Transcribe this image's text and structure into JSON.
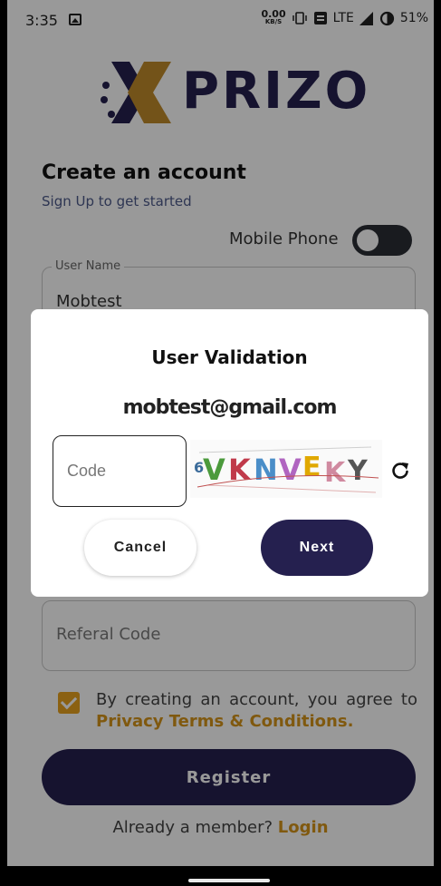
{
  "status_bar": {
    "time": "3:35",
    "speed_value": "0.00",
    "speed_unit": "KB/S",
    "network": "LTE",
    "battery": "51%"
  },
  "logo": {
    "text": "PRIZO",
    "colors": {
      "primary": "#25204f",
      "accent": "#c08a2a"
    }
  },
  "header": {
    "title": "Create an account",
    "subtitle": "Sign Up to get started"
  },
  "mobile_phone": {
    "label": "Mobile Phone",
    "enabled": false
  },
  "form": {
    "username": {
      "label": "User Name",
      "value": "Mobtest"
    },
    "referral_code": {
      "placeholder": "Referal Code"
    }
  },
  "agreement": {
    "checked": true,
    "text": "By creating an account, you agree to",
    "link": "Privacy Terms & Conditions."
  },
  "register_button": "Register",
  "login_prompt": {
    "text": "Already a member?",
    "link": "Login"
  },
  "dialog": {
    "title": "User Validation",
    "email": "mobtest@gmail.com",
    "code_placeholder": "Code",
    "captcha_text": "6VKNVEKY",
    "cancel_label": "Cancel",
    "next_label": "Next"
  },
  "colors": {
    "brand": "#25204f",
    "accent": "#d6951a",
    "checkbox": "#e8a21f"
  }
}
